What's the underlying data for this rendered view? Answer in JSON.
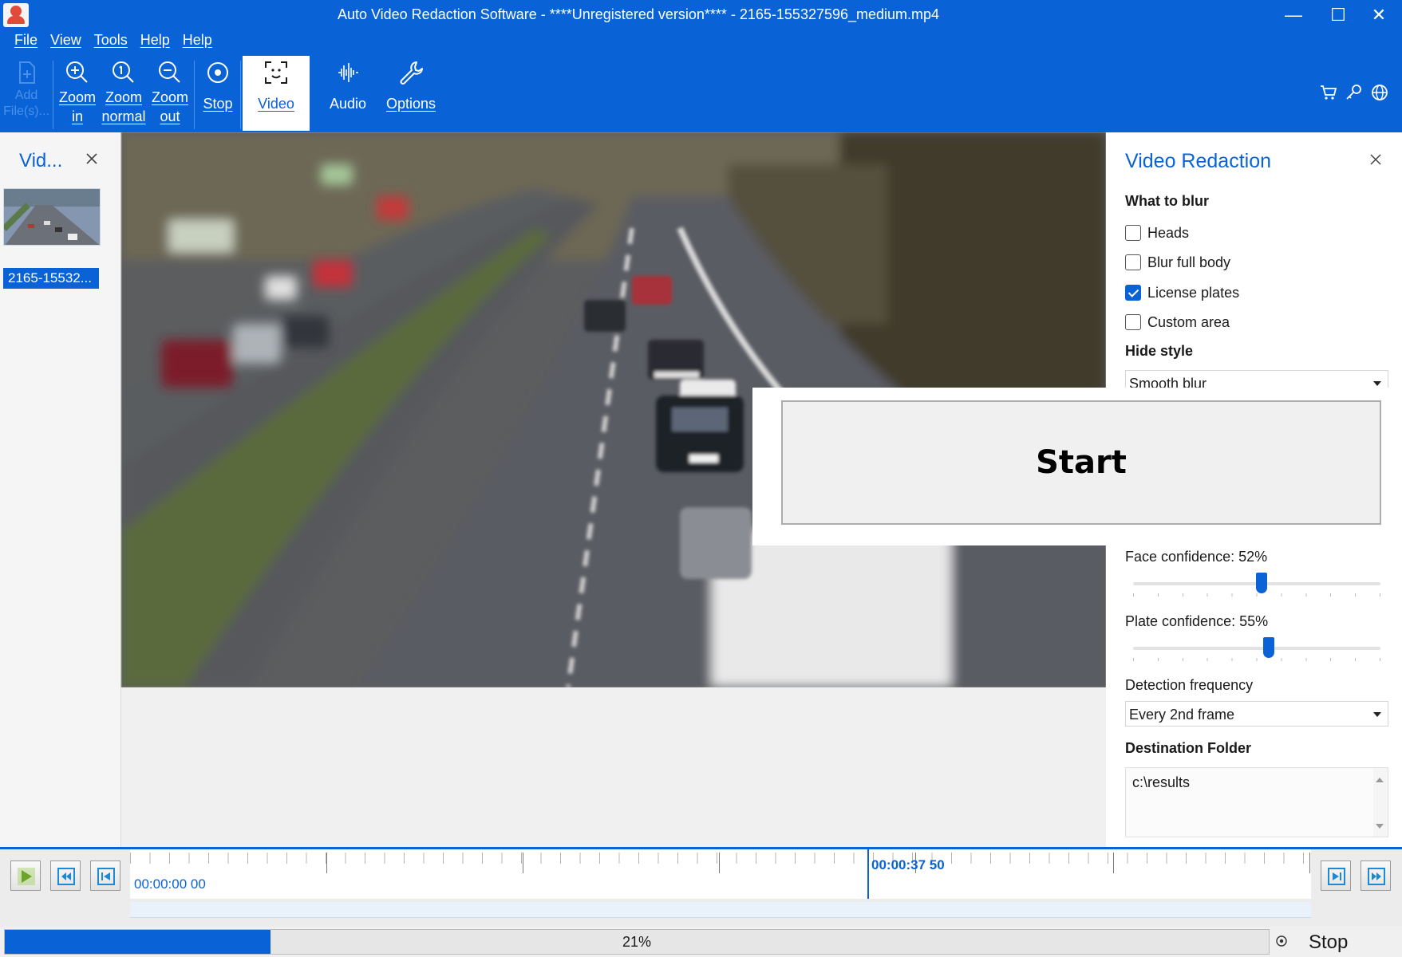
{
  "window": {
    "title": "Auto Video Redaction Software - ****Unregistered version**** - 2165-155327596_medium.mp4",
    "minimize": "—",
    "maximize": "☐",
    "close": "✕"
  },
  "menu": [
    "File",
    "View",
    "Tools",
    "Help",
    "Help"
  ],
  "ribbon": {
    "add_files": "Add File(s)...",
    "zoom_in_1": "Zoom",
    "zoom_in_2": "in",
    "zoom_normal_1": "Zoom",
    "zoom_normal_2": "normal",
    "zoom_out_1": "Zoom",
    "zoom_out_2": "out",
    "stop": "Stop",
    "video": "Video",
    "audio": "Audio",
    "options": "Options"
  },
  "left_panel": {
    "title": "Vid...",
    "file_label": "2165-15532..."
  },
  "right_panel": {
    "title": "Video Redaction",
    "what_to_blur": "What to blur",
    "options": [
      {
        "label": "Heads",
        "checked": false
      },
      {
        "label": "Blur full body",
        "checked": false
      },
      {
        "label": "License plates",
        "checked": true
      },
      {
        "label": "Custom area",
        "checked": false
      }
    ],
    "hide_style": "Hide style",
    "hide_style_value": "Smooth blur",
    "face_confidence": "Face confidence: 52%",
    "face_confidence_value": 52,
    "plate_confidence": "Plate confidence: 55%",
    "plate_confidence_value": 55,
    "detection_frequency": "Detection frequency",
    "detection_frequency_value": "Every 2nd frame",
    "destination_folder": "Destination Folder",
    "destination_value": "c:\\results"
  },
  "start_button": "Start",
  "timeline": {
    "start_time": "00:00:00 00",
    "current_time": "00:00:37 50"
  },
  "status": {
    "progress_text": "21%",
    "progress_value": 21,
    "stop_label": "Stop"
  },
  "colors": {
    "accent": "#0a63d6"
  }
}
